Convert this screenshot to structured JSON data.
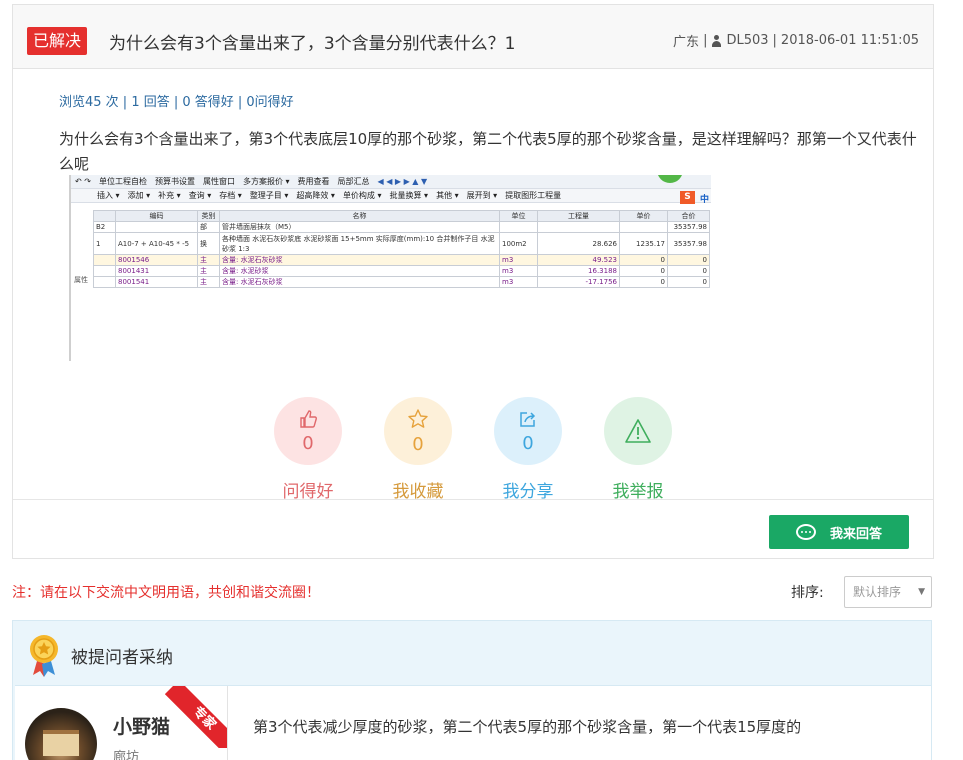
{
  "question": {
    "status_badge": "已解决",
    "title": "为什么会有3个含量出来了，3个含量分别代表什么？1",
    "region": "广东",
    "author": "DL503",
    "time": "2018-06-01 11:51:05",
    "stats": "浏览45 次 | 1 回答 | 0 答得好 | 0问得好",
    "body": "为什么会有3个含量出来了，第3个代表底层10厚的那个砂浆，第二个代表5厚的那个砂浆含量，是这样理解吗？那第一个又代表什么呢"
  },
  "screenshot": {
    "toolbar1": [
      "单位工程自检",
      "预算书设置",
      "属性窗口",
      "多方案报价 ▾",
      "费用查看",
      "局部汇总"
    ],
    "toolbar2": [
      "插入 ▾",
      "添加 ▾",
      "补充 ▾",
      "查询 ▾",
      "存档 ▾",
      "整理子目 ▾",
      "超高降效 ▾",
      "单价构成 ▾",
      "批量换算 ▾",
      "其他 ▾",
      "展开到 ▾",
      "提取图形工程量"
    ],
    "logo_s": "S",
    "logo_z": "中",
    "side_label": "属性",
    "columns": [
      "编码",
      "类别",
      "名称",
      "单位",
      "工程量",
      "单价",
      "合价"
    ],
    "rows": [
      {
        "c0": "B2",
        "c1": "",
        "c2": "部",
        "c3": "管井墙面层抹灰（M5）",
        "c4": "",
        "c5": "",
        "c6": "",
        "c7": "35357.98"
      },
      {
        "c0": "1",
        "c1": "A10-7 + A10-45 * -5",
        "c2": "换",
        "c3": "各种墙面 水泥石灰砂浆底 水泥砂浆面 15+5mm 实际厚度(mm):10 合并制作子目 水泥砂浆 1:3",
        "c4": "100m2",
        "c5": "28.626",
        "c6": "1235.17",
        "c7": "35357.98"
      },
      {
        "c0": "",
        "c1": "8001546",
        "c2": "主",
        "c3": "含量: 水泥石灰砂浆",
        "c4": "m3",
        "c5": "49.523",
        "c6": "0",
        "c7": "0"
      },
      {
        "c0": "",
        "c1": "8001431",
        "c2": "主",
        "c3": "含量: 水泥砂浆",
        "c4": "m3",
        "c5": "16.3188",
        "c6": "0",
        "c7": "0"
      },
      {
        "c0": "",
        "c1": "8001541",
        "c2": "主",
        "c3": "含量: 水泥石灰砂浆",
        "c4": "m3",
        "c5": "-17.1756",
        "c6": "0",
        "c7": "0"
      }
    ]
  },
  "actions": [
    {
      "count": "0",
      "label": "问得好",
      "icon": "thumbs-up-icon"
    },
    {
      "count": "0",
      "label": "我收藏",
      "icon": "star-icon"
    },
    {
      "count": "0",
      "label": "我分享",
      "icon": "share-icon"
    },
    {
      "count": "0",
      "label": "我举报",
      "icon": "warning-icon"
    }
  ],
  "answer_button": "我来回答",
  "notice": "注：请在以下交流中文明用语，共创和谐交流圈！",
  "sort": {
    "label": "排序:",
    "selected": "默认排序"
  },
  "accepted": {
    "header": "被提问者采纳",
    "username": "小野猫",
    "location": "廊坊",
    "badge": "专家",
    "answer": "第3个代表减少厚度的砂浆，第二个代表5厚的那个砂浆含量，第一个代表15厚度的"
  },
  "colors": {
    "solved": "#e5302e",
    "answer_button": "#1aa865",
    "link": "#2c6aa0"
  }
}
